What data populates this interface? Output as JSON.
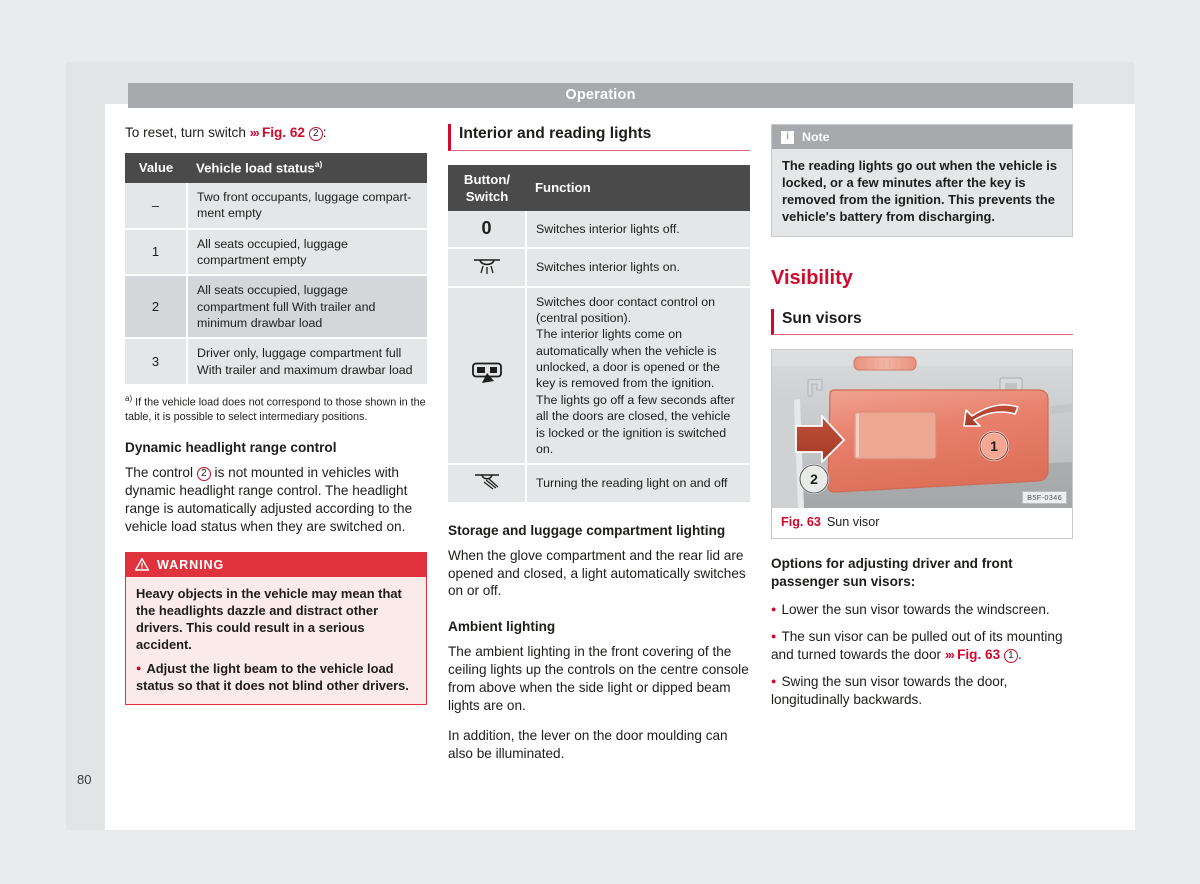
{
  "page": {
    "running_header": "Operation",
    "page_number": "80"
  },
  "col1": {
    "intro_prefix": "To reset, turn switch ",
    "intro_chev": "›››",
    "intro_fig": "Fig. 62",
    "intro_circ": "2",
    "intro_suffix": ":",
    "load_table": {
      "headers": [
        "Value",
        "Vehicle load status"
      ],
      "header2_sup": "a)",
      "rows": [
        {
          "value": "–",
          "status": "Two front occupants, luggage compart-ment empty"
        },
        {
          "value": "1",
          "status": "All seats occupied, luggage compartment empty"
        },
        {
          "value": "2",
          "status": "All seats occupied, luggage compartment full With trailer and minimum drawbar load"
        },
        {
          "value": "3",
          "status": "Driver only, luggage compartment full With trailer and maximum drawbar load"
        }
      ]
    },
    "footnote_marker": "a)",
    "footnote": "If the vehicle load does not correspond to those shown in the table, it is possible to select intermediary positions.",
    "dynamic_head": "Dynamic headlight range control",
    "dynamic_p1_a": "The control ",
    "dynamic_p1_circ": "2",
    "dynamic_p1_b": " is not mounted in vehicles with dynamic headlight range control. The headlight range is automatically adjusted according to the vehicle load status when they are switched on.",
    "warning": {
      "title": "WARNING",
      "icon": "warning-triangle-icon",
      "body1": "Heavy objects in the vehicle may mean that the headlights dazzle and distract other drivers. This could result in a serious accident.",
      "bullet1": "Adjust the light beam to the vehicle load status so that it does not blind other drivers."
    }
  },
  "col2": {
    "section_title": "Interior and reading lights",
    "lights_table": {
      "headers": [
        "Button/ Switch",
        "Function"
      ],
      "rows": [
        {
          "icon": "zero-position-icon",
          "glyph": "0",
          "function": "Switches interior lights off."
        },
        {
          "icon": "interior-light-icon",
          "glyph": "",
          "function": "Switches interior lights on."
        },
        {
          "icon": "door-contact-control-icon",
          "glyph": "",
          "function": "Switches door contact control on (central position).\nThe interior lights come on automatically when the vehicle is unlocked, a door is opened or the key is removed from the ignition.\nThe lights go off a few seconds after all the doors are closed, the vehicle is locked or the ignition is switched on."
        },
        {
          "icon": "reading-light-icon",
          "glyph": "",
          "function": "Turning the reading light on and off"
        }
      ]
    },
    "storage_head": "Storage and luggage compartment lighting",
    "storage_p": "When the glove compartment and the rear lid are opened and closed, a light automatically switches on or off.",
    "ambient_head": "Ambient lighting",
    "ambient_p1": "The ambient lighting in the front covering of the ceiling lights up the controls on the centre console from above when the side light or dipped beam lights are on.",
    "ambient_p2": "In addition, the lever on the door moulding can also be illuminated."
  },
  "col3": {
    "note": {
      "icon": "info-icon",
      "title": "Note",
      "body": "The reading lights go out when the vehicle is locked, or a few minutes after the key is removed from the ignition. This prevents the vehicle's battery from discharging."
    },
    "chapter_title": "Visibility",
    "section_title": "Sun visors",
    "figure": {
      "name": "sun-visor-illustration",
      "code_label": "B5F-0346",
      "callout_1": "1",
      "callout_2": "2",
      "caption_num": "Fig. 63",
      "caption_text": "Sun visor"
    },
    "options_head": "Options for adjusting driver and front passenger sun visors:",
    "bullets": [
      {
        "text": "Lower the sun visor towards the windscreen."
      },
      {
        "text_a": "The sun visor can be pulled out of its mounting and turned towards the door ",
        "chev": "›››",
        "fig": "Fig. 63",
        "circ": "1",
        "text_b": "."
      },
      {
        "text": "Swing the sun visor towards the door, longitudinally backwards."
      }
    ]
  },
  "colors": {
    "brand_red": "#cf0a2c",
    "warning_red": "#e0323c",
    "header_grey": "#a7a9ac",
    "table_head": "#4a4a4a",
    "row_light": "#e4e6e7",
    "row_dark": "#d4d7d9"
  }
}
